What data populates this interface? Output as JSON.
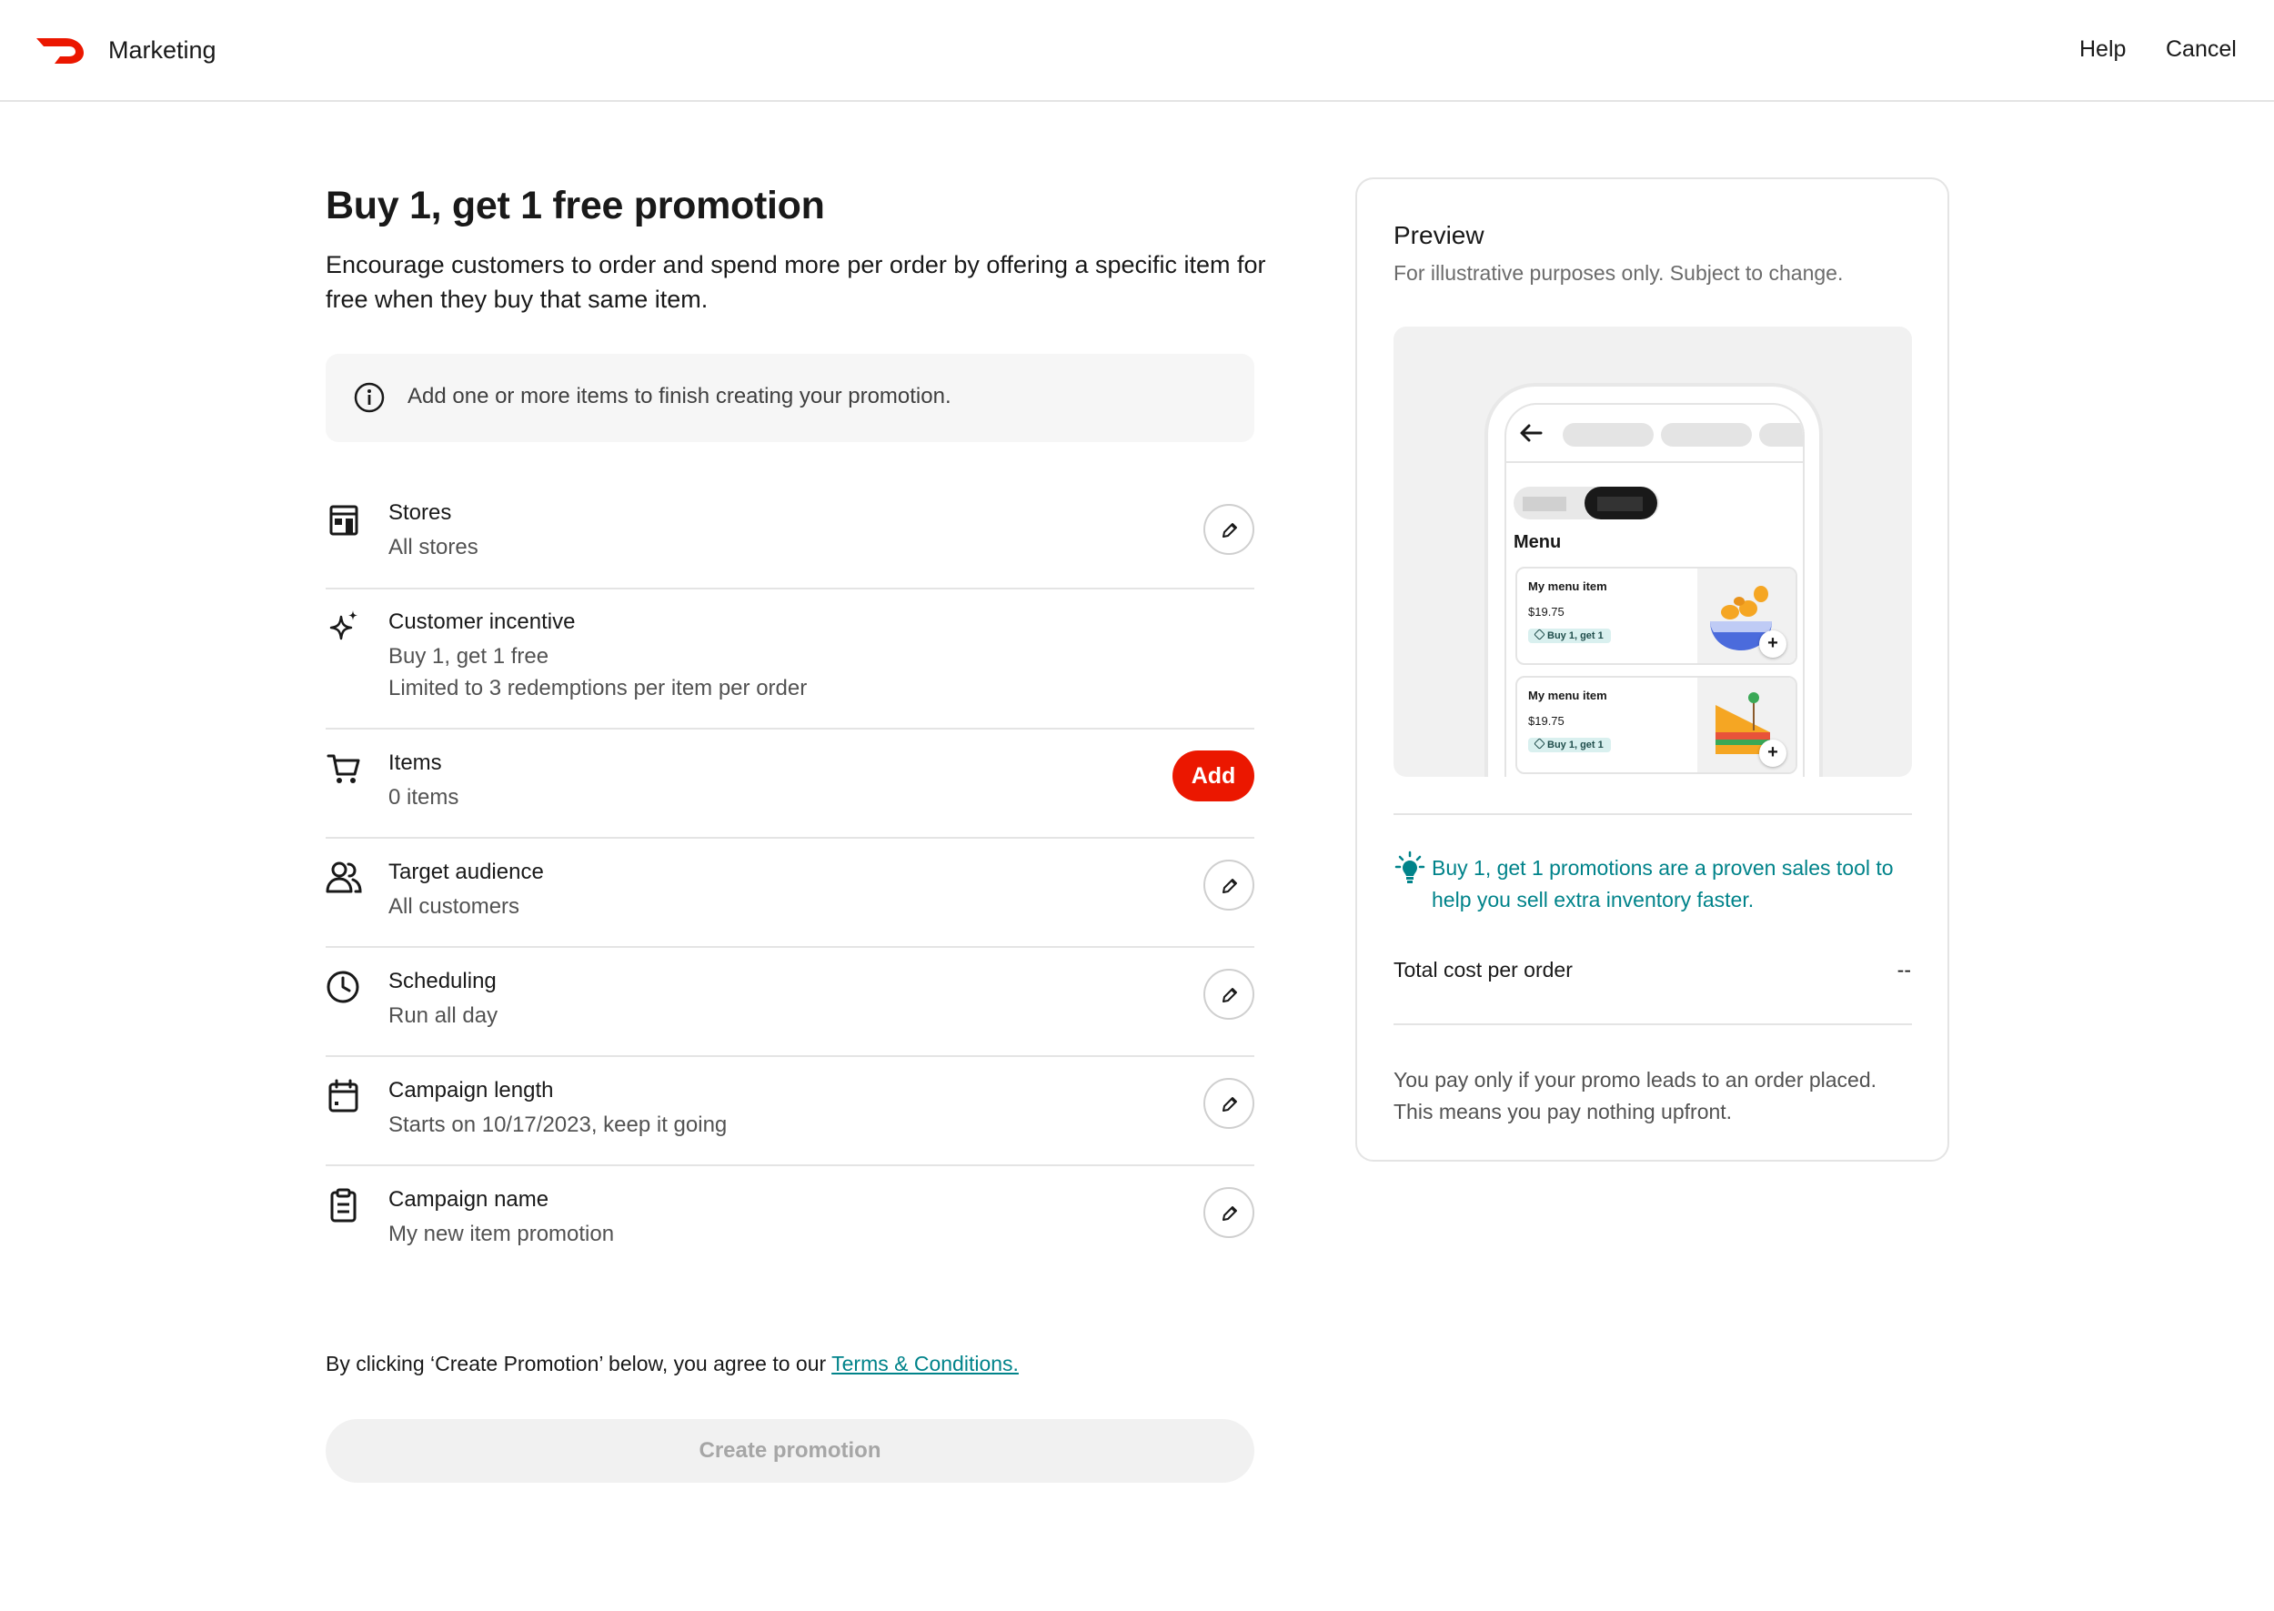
{
  "header": {
    "app_title": "Marketing",
    "help_label": "Help",
    "cancel_label": "Cancel",
    "logo_icon": "doordash-logo-icon",
    "brand_color": "#eb1700"
  },
  "main": {
    "title": "Buy 1, get 1 free promotion",
    "description": "Encourage customers to order and spend more per order by offering a specific item for free when they buy that same item.",
    "info_banner": {
      "icon": "info-icon",
      "text": "Add one or more items to finish creating your promotion."
    },
    "rows": [
      {
        "key": "stores",
        "icon": "store-icon",
        "title": "Stores",
        "lines": [
          "All stores"
        ],
        "action": "edit"
      },
      {
        "key": "customer-incentive",
        "icon": "sparkle-icon",
        "title": "Customer incentive",
        "lines": [
          "Buy 1, get 1 free",
          "Limited to 3 redemptions per item per order"
        ],
        "action": "none"
      },
      {
        "key": "items",
        "icon": "cart-icon",
        "title": "Items",
        "lines": [
          "0 items"
        ],
        "action": "add",
        "action_label": "Add"
      },
      {
        "key": "target-audience",
        "icon": "people-icon",
        "title": "Target audience",
        "lines": [
          "All customers"
        ],
        "action": "edit"
      },
      {
        "key": "scheduling",
        "icon": "clock-icon",
        "title": "Scheduling",
        "lines": [
          "Run all day"
        ],
        "action": "edit"
      },
      {
        "key": "campaign-length",
        "icon": "calendar-icon",
        "title": "Campaign length",
        "lines": [
          "Starts on 10/17/2023, keep it going"
        ],
        "action": "edit"
      },
      {
        "key": "campaign-name",
        "icon": "clipboard-icon",
        "title": "Campaign name",
        "lines": [
          "My new item promotion"
        ],
        "action": "edit"
      }
    ],
    "terms_prefix": "By clicking ‘Create Promotion’ below, you agree to our ",
    "terms_link": "Terms & Conditions.",
    "create_button": "Create promotion",
    "accent_color": "#00838a"
  },
  "preview": {
    "title": "Preview",
    "subtitle": "For illustrative purposes only. Subject to change.",
    "phone": {
      "menu_heading": "Menu",
      "items": [
        {
          "name": "My menu item",
          "price": "$19.75",
          "badge": "Buy 1, get 1",
          "food_icon": "salad-bowl-icon"
        },
        {
          "name": "My menu item",
          "price": "$19.75",
          "badge": "Buy 1, get 1",
          "food_icon": "sandwich-icon"
        }
      ]
    },
    "tip": "Buy 1, get 1 promotions are a proven sales tool to help you sell extra inventory faster.",
    "cost_label": "Total cost per order",
    "cost_value": "--",
    "pay_note": "You pay only if your promo leads to an order placed. This means you pay nothing upfront."
  }
}
